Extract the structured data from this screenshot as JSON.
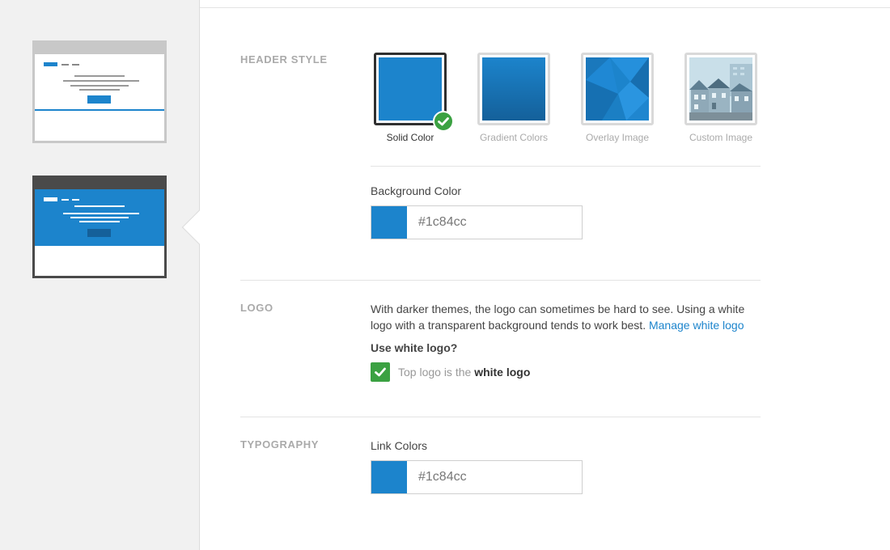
{
  "header_style": {
    "section_label": "Header Style",
    "options": [
      {
        "label": "Solid Color",
        "selected": true
      },
      {
        "label": "Gradient Colors",
        "selected": false
      },
      {
        "label": "Overlay Image",
        "selected": false
      },
      {
        "label": "Custom Image",
        "selected": false
      }
    ],
    "background_color": {
      "label": "Background Color",
      "value": "#1c84cc"
    }
  },
  "logo": {
    "section_label": "Logo",
    "description": "With darker themes, the logo can sometimes be hard to see. Using a white logo with a transparent background tends to work best.",
    "manage_link": "Manage white logo",
    "question": "Use white logo?",
    "checkbox": {
      "checked": true,
      "text_prefix": "Top logo is the",
      "text_bold": "white logo"
    }
  },
  "typography": {
    "section_label": "Typography",
    "link_colors": {
      "label": "Link Colors",
      "value": "#1c84cc"
    }
  },
  "colors": {
    "accent": "#1c84cc",
    "check_green": "#3ba142",
    "selected_border": "#2f2f2f"
  }
}
